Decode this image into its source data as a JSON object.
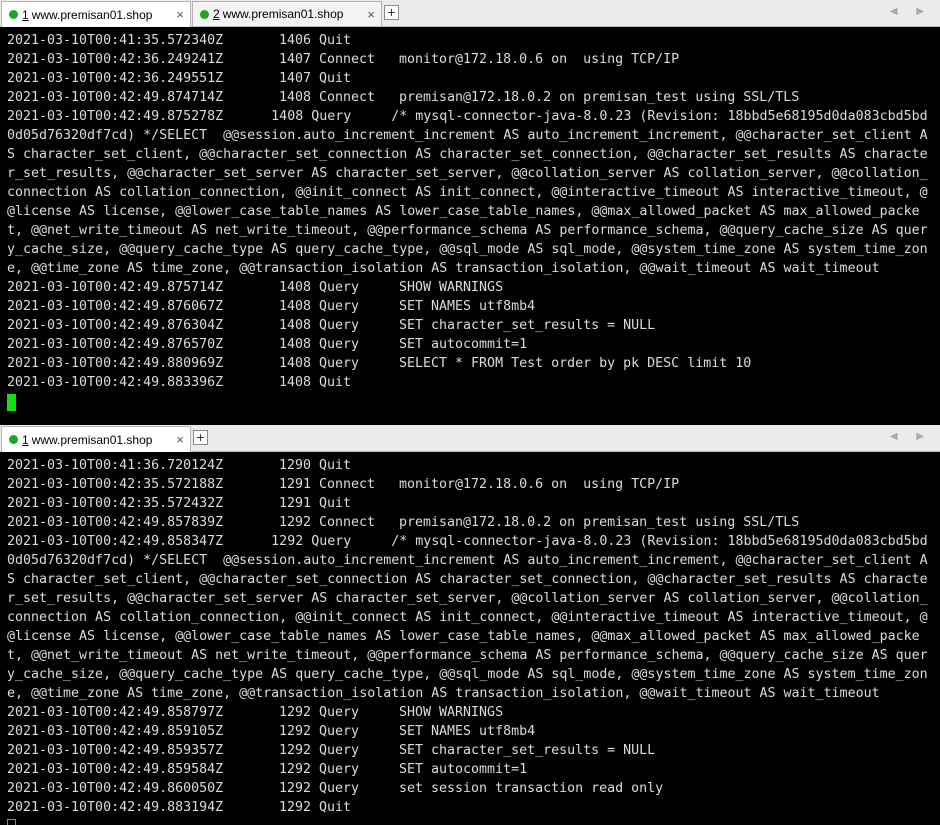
{
  "top": {
    "tabs": [
      {
        "num": "1",
        "title": "www.premisan01.shop",
        "close": "×",
        "active": true
      },
      {
        "num": "2",
        "title": "www.premisan01.shop",
        "close": "×",
        "active": false
      }
    ],
    "add_tab": "+",
    "nav_arrows": "◀ ▶",
    "lines": [
      {
        "ts": "2021-03-10T00:41:35.572340Z",
        "id": "1406",
        "cmd": "Quit",
        "arg": ""
      },
      {
        "ts": "2021-03-10T00:42:36.249241Z",
        "id": "1407",
        "cmd": "Connect",
        "arg": "monitor@172.18.0.6 on  using TCP/IP"
      },
      {
        "ts": "2021-03-10T00:42:36.249551Z",
        "id": "1407",
        "cmd": "Quit",
        "arg": ""
      },
      {
        "ts": "2021-03-10T00:42:49.874714Z",
        "id": "1408",
        "cmd": "Connect",
        "arg": "premisan@172.18.0.2 on premisan_test using SSL/TLS"
      }
    ],
    "long_query": "2021-03-10T00:42:49.875278Z      1408 Query     /* mysql-connector-java-8.0.23 (Revision: 18bbd5e68195d0da083cbd5bd0d05d76320df7cd) */SELECT  @@session.auto_increment_increment AS auto_increment_increment, @@character_set_client AS character_set_client, @@character_set_connection AS character_set_connection, @@character_set_results AS character_set_results, @@character_set_server AS character_set_server, @@collation_server AS collation_server, @@collation_connection AS collation_connection, @@init_connect AS init_connect, @@interactive_timeout AS interactive_timeout, @@license AS license, @@lower_case_table_names AS lower_case_table_names, @@max_allowed_packet AS max_allowed_packet, @@net_write_timeout AS net_write_timeout, @@performance_schema AS performance_schema, @@query_cache_size AS query_cache_size, @@query_cache_type AS query_cache_type, @@sql_mode AS sql_mode, @@system_time_zone AS system_time_zone, @@time_zone AS time_zone, @@transaction_isolation AS transaction_isolation, @@wait_timeout AS wait_timeout",
    "lines_after": [
      {
        "ts": "2021-03-10T00:42:49.875714Z",
        "id": "1408",
        "cmd": "Query",
        "arg": "SHOW WARNINGS"
      },
      {
        "ts": "2021-03-10T00:42:49.876067Z",
        "id": "1408",
        "cmd": "Query",
        "arg": "SET NAMES utf8mb4"
      },
      {
        "ts": "2021-03-10T00:42:49.876304Z",
        "id": "1408",
        "cmd": "Query",
        "arg": "SET character_set_results = NULL"
      },
      {
        "ts": "2021-03-10T00:42:49.876570Z",
        "id": "1408",
        "cmd": "Query",
        "arg": "SET autocommit=1"
      },
      {
        "ts": "2021-03-10T00:42:49.880969Z",
        "id": "1408",
        "cmd": "Query",
        "arg": "SELECT * FROM Test order by pk DESC limit 10"
      },
      {
        "ts": "2021-03-10T00:42:49.883396Z",
        "id": "1408",
        "cmd": "Quit",
        "arg": ""
      }
    ]
  },
  "bottom": {
    "tabs": [
      {
        "num": "1",
        "title": "www.premisan01.shop",
        "close": "×",
        "active": true
      }
    ],
    "add_tab": "+",
    "nav_arrows": "◀ ▶",
    "lines": [
      {
        "ts": "2021-03-10T00:41:36.720124Z",
        "id": "1290",
        "cmd": "Quit",
        "arg": ""
      },
      {
        "ts": "2021-03-10T00:42:35.572188Z",
        "id": "1291",
        "cmd": "Connect",
        "arg": "monitor@172.18.0.6 on  using TCP/IP"
      },
      {
        "ts": "2021-03-10T00:42:35.572432Z",
        "id": "1291",
        "cmd": "Quit",
        "arg": ""
      },
      {
        "ts": "2021-03-10T00:42:49.857839Z",
        "id": "1292",
        "cmd": "Connect",
        "arg": "premisan@172.18.0.2 on premisan_test using SSL/TLS"
      }
    ],
    "long_query": "2021-03-10T00:42:49.858347Z      1292 Query     /* mysql-connector-java-8.0.23 (Revision: 18bbd5e68195d0da083cbd5bd0d05d76320df7cd) */SELECT  @@session.auto_increment_increment AS auto_increment_increment, @@character_set_client AS character_set_client, @@character_set_connection AS character_set_connection, @@character_set_results AS character_set_results, @@character_set_server AS character_set_server, @@collation_server AS collation_server, @@collation_connection AS collation_connection, @@init_connect AS init_connect, @@interactive_timeout AS interactive_timeout, @@license AS license, @@lower_case_table_names AS lower_case_table_names, @@max_allowed_packet AS max_allowed_packet, @@net_write_timeout AS net_write_timeout, @@performance_schema AS performance_schema, @@query_cache_size AS query_cache_size, @@query_cache_type AS query_cache_type, @@sql_mode AS sql_mode, @@system_time_zone AS system_time_zone, @@time_zone AS time_zone, @@transaction_isolation AS transaction_isolation, @@wait_timeout AS wait_timeout",
    "lines_after": [
      {
        "ts": "2021-03-10T00:42:49.858797Z",
        "id": "1292",
        "cmd": "Query",
        "arg": "SHOW WARNINGS"
      },
      {
        "ts": "2021-03-10T00:42:49.859105Z",
        "id": "1292",
        "cmd": "Query",
        "arg": "SET NAMES utf8mb4"
      },
      {
        "ts": "2021-03-10T00:42:49.859357Z",
        "id": "1292",
        "cmd": "Query",
        "arg": "SET character_set_results = NULL"
      },
      {
        "ts": "2021-03-10T00:42:49.859584Z",
        "id": "1292",
        "cmd": "Query",
        "arg": "SET autocommit=1"
      },
      {
        "ts": "2021-03-10T00:42:49.860050Z",
        "id": "1292",
        "cmd": "Query",
        "arg": "set session transaction read only"
      },
      {
        "ts": "2021-03-10T00:42:49.883194Z",
        "id": "1292",
        "cmd": "Quit",
        "arg": ""
      }
    ]
  },
  "colors": {
    "terminal_bg": "#000000",
    "terminal_fg": "#dcdcdc",
    "cursor": "#10e010",
    "session_dot": "#1fa51f"
  }
}
